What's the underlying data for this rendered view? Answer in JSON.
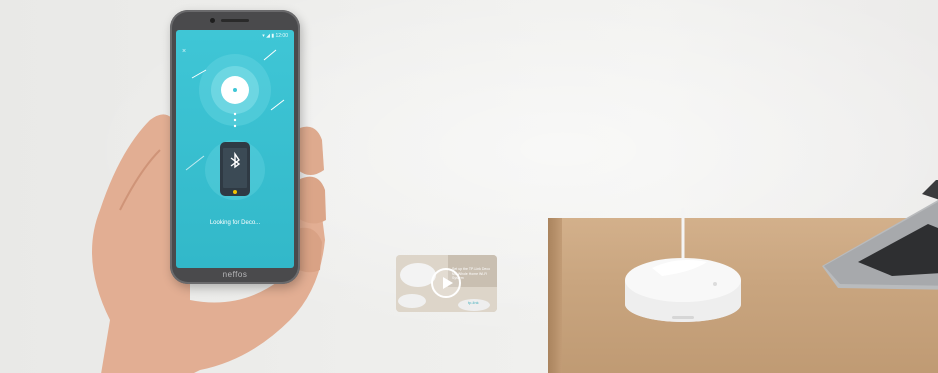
{
  "phone": {
    "brand": "neffos",
    "screen_status": "▾ ◢ ▮ 12:00",
    "screen_caption": "Looking for Deco...",
    "close_glyph": "×"
  },
  "video_thumbnail": {
    "overlay_text": "Set up the TP-Link Deco M5 Whole Home Wi-Fi System",
    "logo_text": "tp-link"
  },
  "colors": {
    "screen_teal": "#3fc6d6",
    "desk_wood": "#c9a57f",
    "wall": "#eeeeec",
    "router_white": "#f7f7f7"
  },
  "icons": [
    "bluetooth-icon",
    "play-icon",
    "close-icon"
  ]
}
